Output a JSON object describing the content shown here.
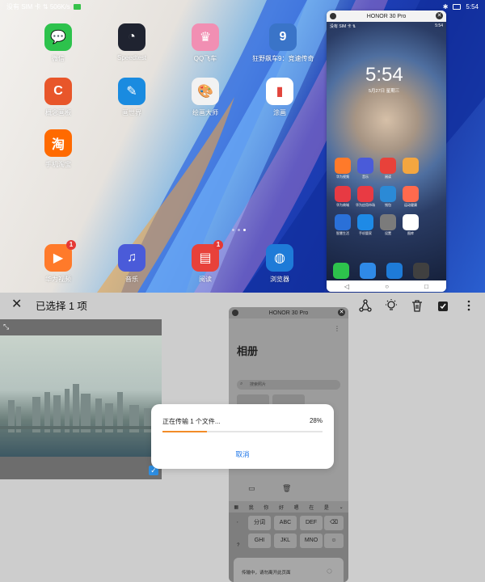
{
  "statusbar": {
    "left": "没有 SIM 卡 ⇅ 506K/s",
    "time": "5:54"
  },
  "home": {
    "apps": [
      {
        "label": "微信",
        "color": "#2dc24c",
        "glyph": "💬",
        "icon": "wechat-icon",
        "badge": ""
      },
      {
        "label": "Speedtest",
        "color": "#1f2330",
        "glyph": "◔",
        "icon": "speedometer-icon",
        "badge": ""
      },
      {
        "label": "QQ飞车",
        "color": "#f18fb3",
        "glyph": "♛",
        "icon": "game-qq-speed-icon",
        "badge": ""
      },
      {
        "label": "狂野飙车9：竞速传奇",
        "color": "#3a74c8",
        "glyph": "9",
        "icon": "game-asphalt-icon",
        "badge": ""
      },
      {
        "label": "概念画板",
        "color": "#e8562a",
        "glyph": "C",
        "icon": "concepts-icon",
        "badge": ""
      },
      {
        "label": "画世界",
        "color": "#1a8be0",
        "glyph": "✎",
        "icon": "brush-icon",
        "badge": ""
      },
      {
        "label": "绘画大师",
        "color": "#f2f2f2",
        "glyph": "🎨",
        "icon": "palette-icon",
        "badge": ""
      },
      {
        "label": "涂画",
        "color": "#ffffff",
        "glyph": "▮",
        "icon": "color-fan-icon",
        "badge": ""
      },
      {
        "label": "手机淘宝",
        "color": "#ff6a00",
        "glyph": "淘",
        "icon": "taobao-icon",
        "badge": ""
      }
    ],
    "dock": [
      {
        "label": "华为视频",
        "color": "#ff7a2a",
        "glyph": "▶",
        "icon": "video-icon",
        "badge": "1"
      },
      {
        "label": "音乐",
        "color": "#4a5bd9",
        "glyph": "♫",
        "icon": "music-icon",
        "badge": ""
      },
      {
        "label": "阅读",
        "color": "#e8413a",
        "glyph": "▤",
        "icon": "book-icon",
        "badge": "1"
      },
      {
        "label": "浏览器",
        "color": "#1e7bd8",
        "glyph": "◍",
        "icon": "browser-icon",
        "badge": ""
      }
    ]
  },
  "mirror": {
    "title": "HONOR 30 Pro",
    "status_left": "没有 SIM 卡 ⇅",
    "status_right": "5:54",
    "time": "5:54",
    "date": "5月27日 星期三",
    "apps": [
      {
        "label": "华为视频",
        "color": "#ff7a2a"
      },
      {
        "label": "音乐",
        "color": "#4a5bd9"
      },
      {
        "label": "阅读",
        "color": "#e8413a"
      },
      {
        "label": "",
        "color": "#f4a640"
      },
      {
        "label": "",
        "color": "transparent"
      },
      {
        "label": "华为商城",
        "color": "#e73a43"
      },
      {
        "label": "华为应用市场",
        "color": "#e93a43"
      },
      {
        "label": "钱包",
        "color": "#2b8ad6"
      },
      {
        "label": "运动健康",
        "color": "#ff6a4d"
      },
      {
        "label": "",
        "color": "transparent"
      },
      {
        "label": "智慧生活",
        "color": "#2a70d8"
      },
      {
        "label": "手机管家",
        "color": "#1e8ae6"
      },
      {
        "label": "设置",
        "color": "#7b7b7b"
      },
      {
        "label": "图库",
        "color": "#ffffff"
      },
      {
        "label": "",
        "color": "transparent"
      }
    ],
    "dock": [
      {
        "color": "#2dc24c"
      },
      {
        "color": "#2f8ae8"
      },
      {
        "color": "#1e7bd8"
      },
      {
        "color": "#404040"
      }
    ]
  },
  "gallery": {
    "title": "已选择 1 项",
    "tools": [
      "share-icon",
      "lightbulb-icon",
      "trash-icon",
      "select-all-icon",
      "more-icon"
    ]
  },
  "mirror2": {
    "title": "HONOR 30 Pro",
    "heading": "相册",
    "search_placeholder": "搜索照片",
    "kb_suggest": [
      "我",
      "你",
      "好",
      "嗯",
      "在",
      "是"
    ],
    "keys": [
      "分词",
      "ABC",
      "DEF",
      "GHI",
      "JKL",
      "MNO"
    ],
    "toast": "传输中，请勿离开此页面"
  },
  "dialog": {
    "message": "正在传输 1 个文件...",
    "percent_text": "28%",
    "progress": 0.28,
    "cancel": "取消"
  }
}
